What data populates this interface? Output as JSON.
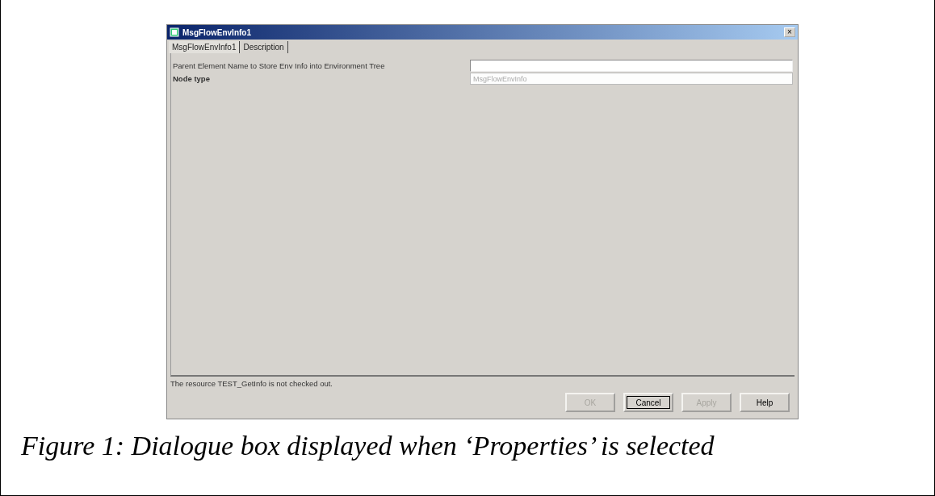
{
  "window": {
    "title": "MsgFlowEnvInfo1",
    "close": "×"
  },
  "tabs": [
    {
      "label": "MsgFlowEnvInfo1",
      "selected": true
    },
    {
      "label": "Description",
      "selected": false
    }
  ],
  "fields": [
    {
      "label": "Parent Element Name to Store Env Info into Environment Tree",
      "bold": false,
      "disabled": false
    },
    {
      "label": "Node type",
      "bold": true,
      "value": "MsgFlowEnvInfo",
      "disabled": true
    }
  ],
  "status_bar": "The resource TEST_GetInfo is not checked out.",
  "buttons": [
    {
      "label": "OK",
      "disabled": true,
      "default": false
    },
    {
      "label": "Cancel",
      "disabled": false,
      "default": true
    },
    {
      "label": "Apply",
      "disabled": true,
      "default": false
    },
    {
      "label": "Help",
      "disabled": false,
      "default": false
    }
  ],
  "caption": "Figure 1: Dialogue box displayed when ‘Properties’ is selected"
}
